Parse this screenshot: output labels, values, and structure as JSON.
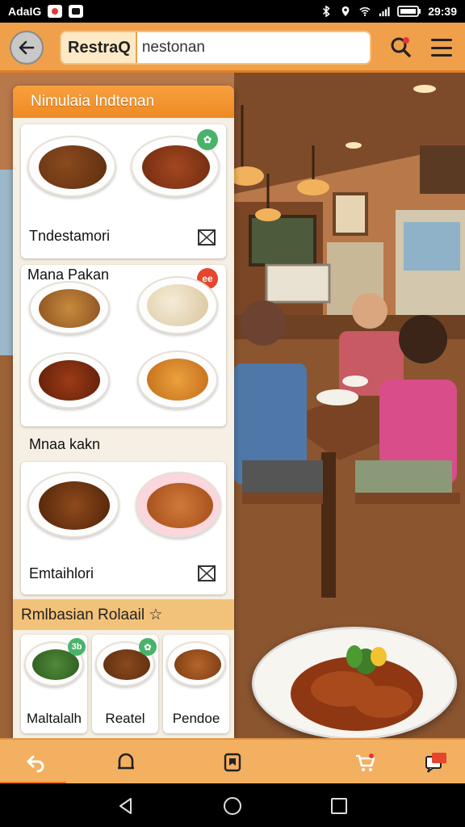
{
  "status_bar": {
    "carrier": "AdaIG",
    "time": "29:39"
  },
  "app_bar": {
    "brand": "RestraQ",
    "search_value": "nestonan",
    "back_icon": "arrow-left-icon",
    "search_icon": "search-icon",
    "menu_icon": "hamburger-menu-icon"
  },
  "panel": {
    "header": "Nimulaia Indtenan",
    "card1": {
      "title": "Tndestamori"
    },
    "card2": {
      "title": "Mana Pakan",
      "badge": "ee"
    },
    "card3": {
      "heading": "Mnaa kakn",
      "title": "Emtaihlori"
    },
    "section": {
      "title": "Rmlbasian Rolaail ☆"
    },
    "mini": [
      {
        "label": "Maltalalh",
        "badge": "3b"
      },
      {
        "label": "Reatel"
      },
      {
        "label": "Pendoe"
      }
    ]
  },
  "bottom_nav": {
    "items": [
      "back-icon",
      "home-icon",
      "bookmark-icon",
      "cart-icon",
      "chat-icon"
    ]
  },
  "colors": {
    "accent": "#f0a04a",
    "header": "#ef8a24",
    "badge_green": "#49b36b",
    "badge_red": "#e5462c"
  }
}
